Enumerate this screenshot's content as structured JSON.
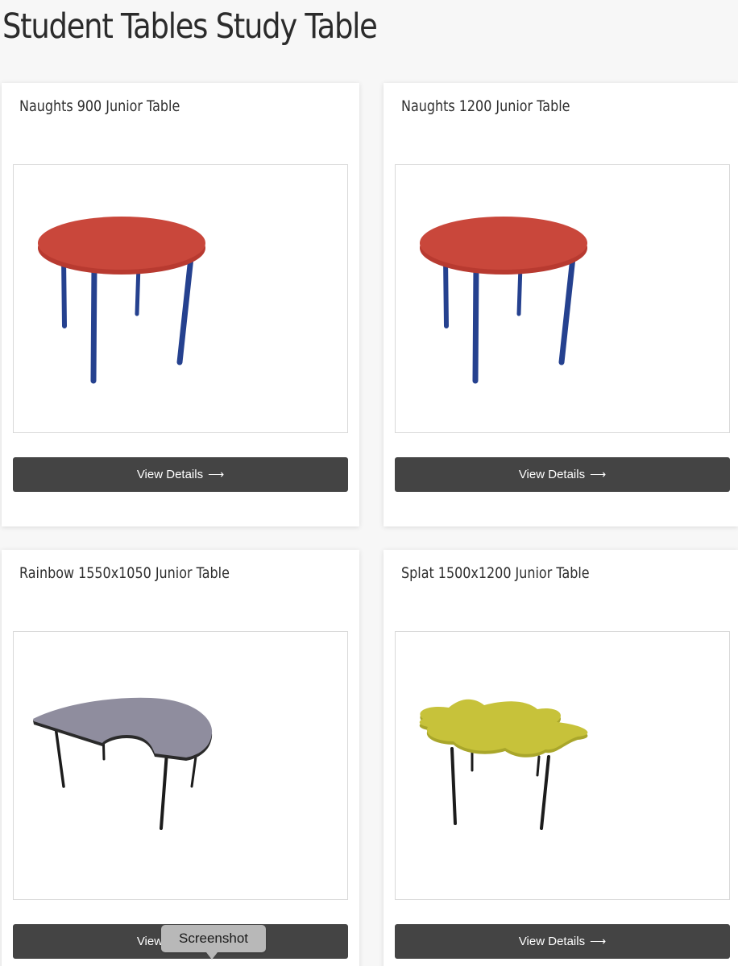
{
  "page": {
    "title": "Student Tables Study Table"
  },
  "products": [
    {
      "name": "Naughts 900 Junior Table",
      "button_label": "View Details",
      "image": "red-round-table-blue-legs"
    },
    {
      "name": "Naughts 1200 Junior Table",
      "button_label": "View Details",
      "image": "red-round-table-blue-legs"
    },
    {
      "name": "Rainbow 1550x1050 Junior Table",
      "button_label": "View Details",
      "image": "lilac-crescent-table-black-legs"
    },
    {
      "name": "Splat 1500x1200 Junior Table",
      "button_label": "View Details",
      "image": "yellow-splat-table-black-legs"
    }
  ],
  "icons": {
    "button_arrow": "right-arrow-icon"
  },
  "tooltip": {
    "text": "Screenshot"
  },
  "colors": {
    "button_bg": "#444444",
    "red_top": "#c9473b",
    "blue_leg": "#25418f",
    "lilac_top": "#8f8d9e",
    "yellow_top": "#c7c23a"
  }
}
